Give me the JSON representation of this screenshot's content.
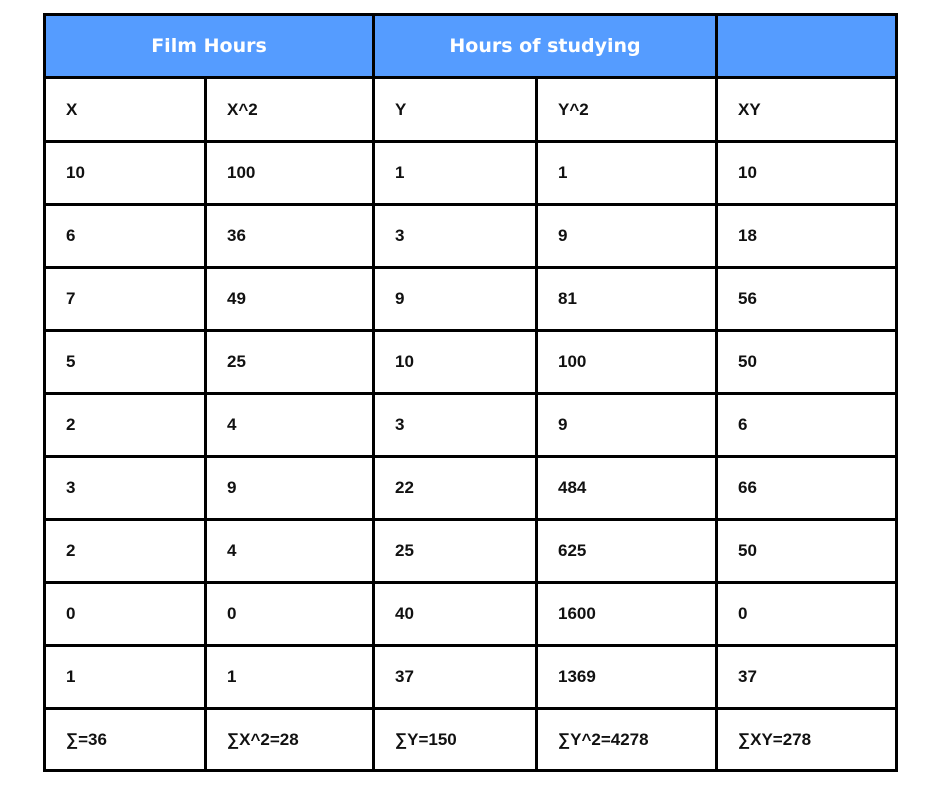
{
  "table": {
    "group_headers": [
      "Film Hours",
      "Hours of studying",
      ""
    ],
    "columns": [
      "X",
      "X^2",
      "Y",
      "Y^2",
      "XY"
    ],
    "rows": [
      [
        "10",
        "100",
        "1",
        "1",
        "10"
      ],
      [
        "6",
        "36",
        "3",
        "9",
        "18"
      ],
      [
        "7",
        "49",
        "9",
        "81",
        "56"
      ],
      [
        "5",
        "25",
        "10",
        "100",
        "50"
      ],
      [
        "2",
        "4",
        "3",
        "9",
        "6"
      ],
      [
        "3",
        "9",
        "22",
        "484",
        "66"
      ],
      [
        "2",
        "4",
        "25",
        "625",
        "50"
      ],
      [
        "0",
        "0",
        "40",
        "1600",
        "0"
      ],
      [
        "1",
        "1",
        "37",
        "1369",
        "37"
      ]
    ],
    "sums": [
      "∑=36",
      "∑X^2=28",
      "∑Y=150",
      "∑Y^2=4278",
      "∑XY=278"
    ]
  },
  "colors": {
    "header_bg": "#559cff",
    "header_text": "#ffffff",
    "border": "#000000"
  }
}
